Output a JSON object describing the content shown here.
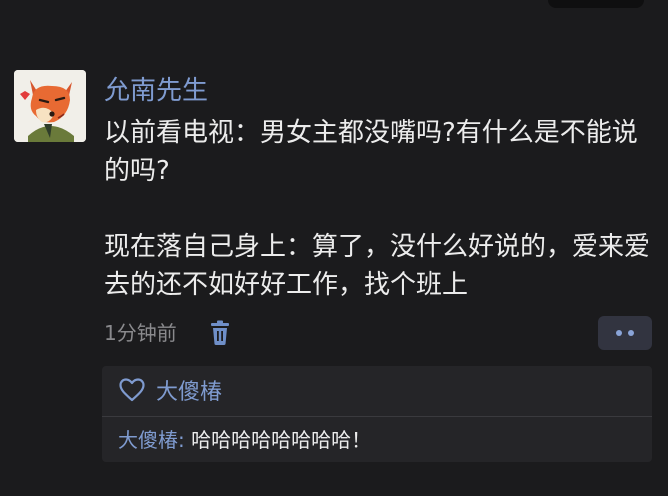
{
  "post": {
    "author": "允南先生",
    "paragraph1": "以前看电视：男女主都没嘴吗?有什么是不能说的吗?",
    "paragraph2": "现在落自己身上：算了，没什么好说的，爱来爱去的还不如好好工作，找个班上",
    "timestamp": "1分钟前"
  },
  "likes": {
    "names": "大傻椿"
  },
  "comments": [
    {
      "author": "大傻椿",
      "separator": ": ",
      "text": "哈哈哈哈哈哈哈哈！"
    }
  ],
  "icons": {
    "avatar": "fox-avatar-icon",
    "delete": "trash-icon",
    "more": "more-dots-icon",
    "like": "heart-outline-icon"
  },
  "colors": {
    "background": "#1b1b1d",
    "name_link": "#7f9bd0",
    "text": "#ececec",
    "muted": "#8a8a8d",
    "panel": "#252528"
  }
}
